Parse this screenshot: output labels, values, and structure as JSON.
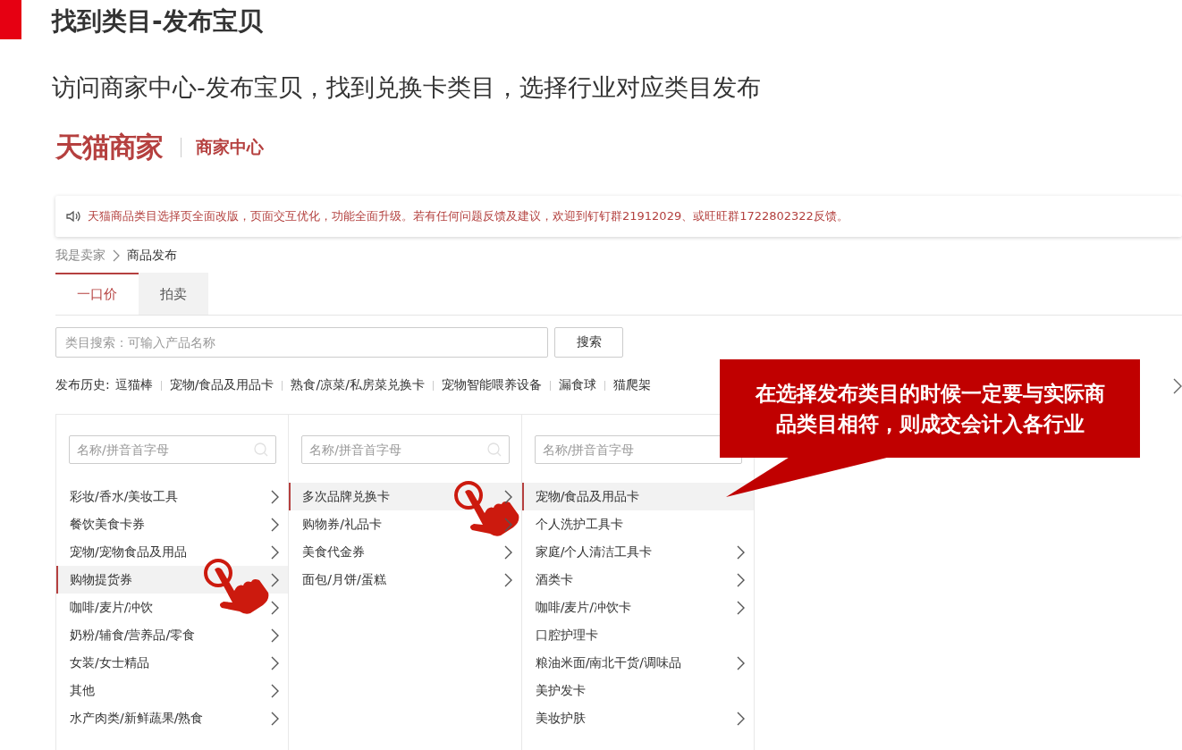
{
  "slide": {
    "title": "找到类目-发布宝贝",
    "subtitle": "访问商家中心-发布宝贝，找到兑换卡类目，选择行业对应类目发布"
  },
  "header": {
    "logo": "天猫商家",
    "section": "商家中心"
  },
  "notice": "天猫商品类目选择页全面改版，页面交互优化，功能全面升级。若有任何问题反馈及建议，欢迎到钉钉群21912029、或旺旺群1722802322反馈。",
  "breadcrumb": [
    "我是卖家",
    "商品发布"
  ],
  "tabs": [
    {
      "label": "一口价",
      "selected": true
    },
    {
      "label": "拍卖",
      "selected": false
    }
  ],
  "search": {
    "placeholder": "类目搜索：可输入产品名称",
    "button": "搜索"
  },
  "history": {
    "label": "发布历史:",
    "items": [
      "逗猫棒",
      "宠物/食品及用品卡",
      "熟食/凉菜/私房菜兑换卡",
      "宠物智能喂养设备",
      "漏食球",
      "猫爬架"
    ]
  },
  "columns": [
    {
      "placeholder": "名称/拼音首字母",
      "items": [
        {
          "label": "彩妆/香水/美妆工具",
          "has_children": true,
          "selected": false
        },
        {
          "label": "餐饮美食卡券",
          "has_children": true,
          "selected": false
        },
        {
          "label": "宠物/宠物食品及用品",
          "has_children": true,
          "selected": false
        },
        {
          "label": "购物提货券",
          "has_children": true,
          "selected": true
        },
        {
          "label": "咖啡/麦片/冲饮",
          "has_children": true,
          "selected": false
        },
        {
          "label": "奶粉/辅食/营养品/零食",
          "has_children": true,
          "selected": false
        },
        {
          "label": "女装/女士精品",
          "has_children": true,
          "selected": false
        },
        {
          "label": "其他",
          "has_children": true,
          "selected": false
        },
        {
          "label": "水产肉类/新鲜蔬果/熟食",
          "has_children": true,
          "selected": false
        }
      ]
    },
    {
      "placeholder": "名称/拼音首字母",
      "items": [
        {
          "label": "多次品牌兑换卡",
          "has_children": true,
          "selected": true
        },
        {
          "label": "购物券/礼品卡",
          "has_children": true,
          "selected": false
        },
        {
          "label": "美食代金券",
          "has_children": true,
          "selected": false
        },
        {
          "label": "面包/月饼/蛋糕",
          "has_children": true,
          "selected": false
        }
      ]
    },
    {
      "placeholder": "名称/拼音首字母",
      "items": [
        {
          "label": "宠物/食品及用品卡",
          "has_children": false,
          "selected": true
        },
        {
          "label": "个人洗护工具卡",
          "has_children": false,
          "selected": false
        },
        {
          "label": "家庭/个人清洁工具卡",
          "has_children": true,
          "selected": false
        },
        {
          "label": "酒类卡",
          "has_children": true,
          "selected": false
        },
        {
          "label": "咖啡/麦片/冲饮卡",
          "has_children": true,
          "selected": false
        },
        {
          "label": "口腔护理卡",
          "has_children": false,
          "selected": false
        },
        {
          "label": "粮油米面/南北干货/调味品",
          "has_children": true,
          "selected": false
        },
        {
          "label": "美护发卡",
          "has_children": false,
          "selected": false
        },
        {
          "label": "美妆护肤",
          "has_children": true,
          "selected": false
        }
      ]
    }
  ],
  "callout": "在选择发布类目的时候一定要与实际商品类目相符，则成交会计入各行业"
}
